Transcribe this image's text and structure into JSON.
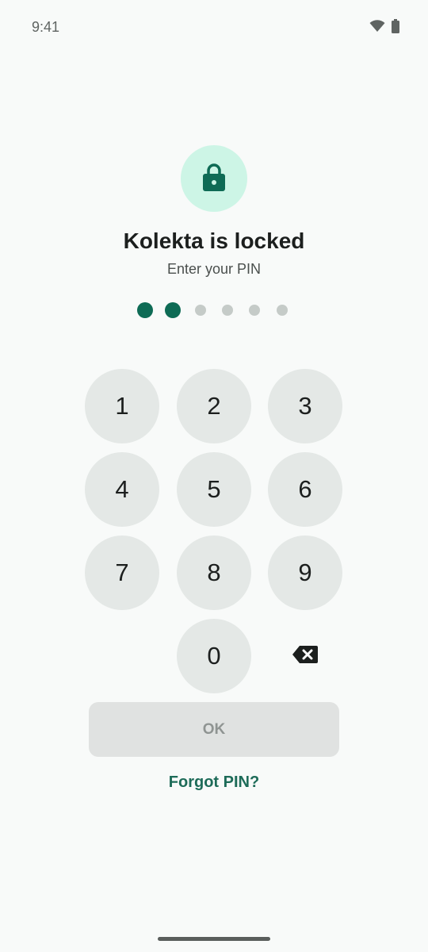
{
  "status_bar": {
    "time": "9:41",
    "icons": [
      "wifi-icon",
      "battery-icon"
    ]
  },
  "lock_screen": {
    "icon": "lock-icon",
    "title": "Kolekta is locked",
    "subtitle": "Enter your PIN",
    "pin_length": 6,
    "pin_entered": 2
  },
  "keypad": {
    "keys": [
      "1",
      "2",
      "3",
      "4",
      "5",
      "6",
      "7",
      "8",
      "9",
      "0"
    ],
    "backspace_icon": "backspace-icon"
  },
  "actions": {
    "ok_label": "OK",
    "ok_enabled": false,
    "forgot_label": "Forgot PIN?"
  },
  "colors": {
    "accent": "#0e6b55",
    "lock_circle": "#cdf5e6",
    "key_background": "#e4e8e6",
    "dot_empty": "#c5cbc8",
    "button_disabled": "#e0e2e1"
  }
}
